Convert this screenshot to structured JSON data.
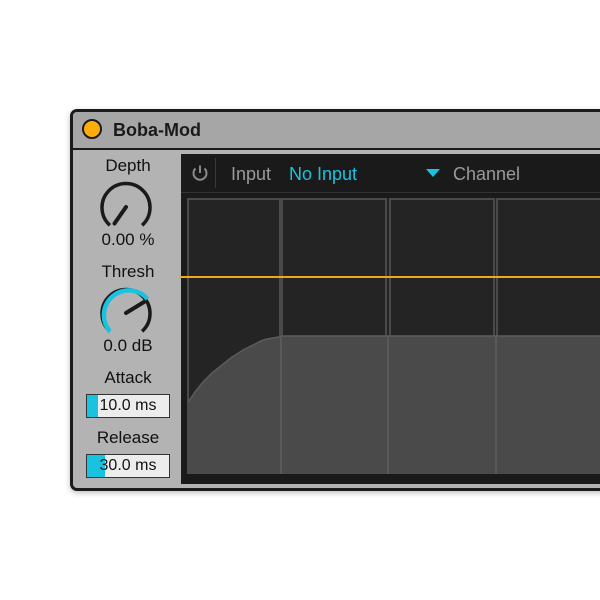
{
  "device": {
    "title": "Boba-Mod",
    "power_color": "#ffad0a",
    "accent_color": "#19c3e0"
  },
  "controls": {
    "depth": {
      "label": "Depth",
      "value": "0.00 %",
      "level": 0.0
    },
    "thresh": {
      "label": "Thresh",
      "value": "0.0 dB",
      "level": 0.75
    },
    "attack": {
      "label": "Attack",
      "value": "10.0 ms",
      "fill_fraction": 0.14
    },
    "release": {
      "label": "Release",
      "value": "30.0 ms",
      "fill_fraction": 0.22
    }
  },
  "panel": {
    "power_icon": "power-icon",
    "input_label": "Input",
    "input_value": "No Input",
    "dropdown_icon": "triangle-down-icon",
    "channel_label": "Channel",
    "threshold_line_color": "#f0a820"
  }
}
